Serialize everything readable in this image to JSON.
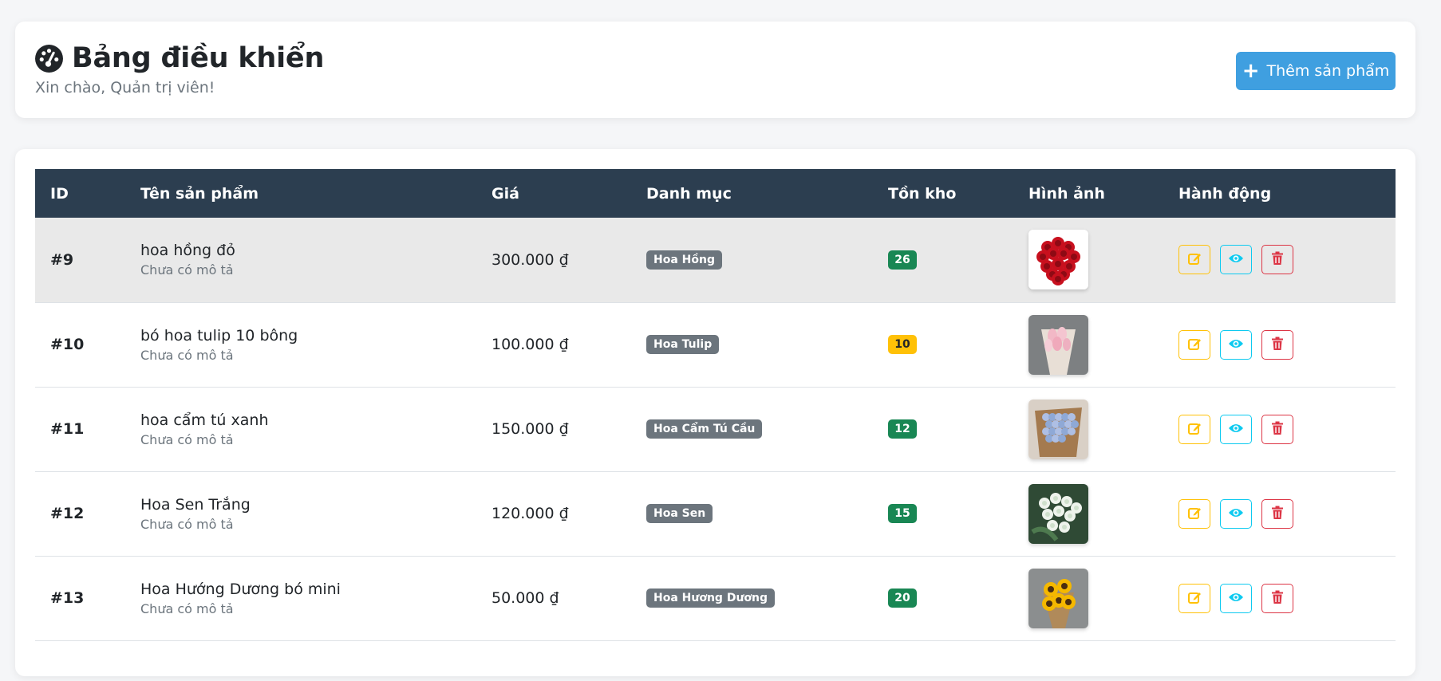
{
  "header": {
    "title": "Bảng điều khiển",
    "subtitle": "Xin chào, Quản trị viên!",
    "add_button_label": "Thêm sản phẩm"
  },
  "table": {
    "columns": [
      "ID",
      "Tên sản phẩm",
      "Giá",
      "Danh mục",
      "Tồn kho",
      "Hình ảnh",
      "Hành động"
    ],
    "rows": [
      {
        "id": "#9",
        "name": "hoa hồng đỏ",
        "desc": "Chưa có mô tả",
        "price": "300.000 ₫",
        "category": "Hoa Hồng",
        "stock": "26",
        "stock_color": "#198754",
        "image": "red-roses-image"
      },
      {
        "id": "#10",
        "name": "bó hoa tulip 10 bông",
        "desc": "Chưa có mô tả",
        "price": "100.000 ₫",
        "category": "Hoa Tulip",
        "stock": "10",
        "stock_color": "#ffc107",
        "image": "pink-tulip-bouquet-image"
      },
      {
        "id": "#11",
        "name": "hoa cẩm tú xanh",
        "desc": "Chưa có mô tả",
        "price": "150.000 ₫",
        "category": "Hoa Cẩm Tú Cầu",
        "stock": "12",
        "stock_color": "#198754",
        "image": "blue-hydrangea-bouquet-image"
      },
      {
        "id": "#12",
        "name": "Hoa Sen Trắng",
        "desc": "Chưa có mô tả",
        "price": "120.000 ₫",
        "category": "Hoa Sen",
        "stock": "15",
        "stock_color": "#198754",
        "image": "white-lotus-bouquet-image"
      },
      {
        "id": "#13",
        "name": "Hoa Hướng Dương bó mini",
        "desc": "Chưa có mô tả",
        "price": "50.000 ₫",
        "category": "Hoa Hương Dương",
        "stock": "20",
        "stock_color": "#198754",
        "image": "sunflower-bouquet-image"
      }
    ]
  },
  "icons": {
    "dashboard": "tachometer-icon",
    "add": "plus-icon",
    "edit": "edit-icon",
    "view": "eye-icon",
    "delete": "trash-icon"
  },
  "colors": {
    "table_header": "#2c3e50",
    "primary_button": "#3f9fe0",
    "edit": "#ffc107",
    "view": "#0dcaf0",
    "delete": "#dc3545",
    "badge_gray": "#6c757d",
    "stock_ok": "#198754",
    "stock_low": "#ffc107"
  }
}
